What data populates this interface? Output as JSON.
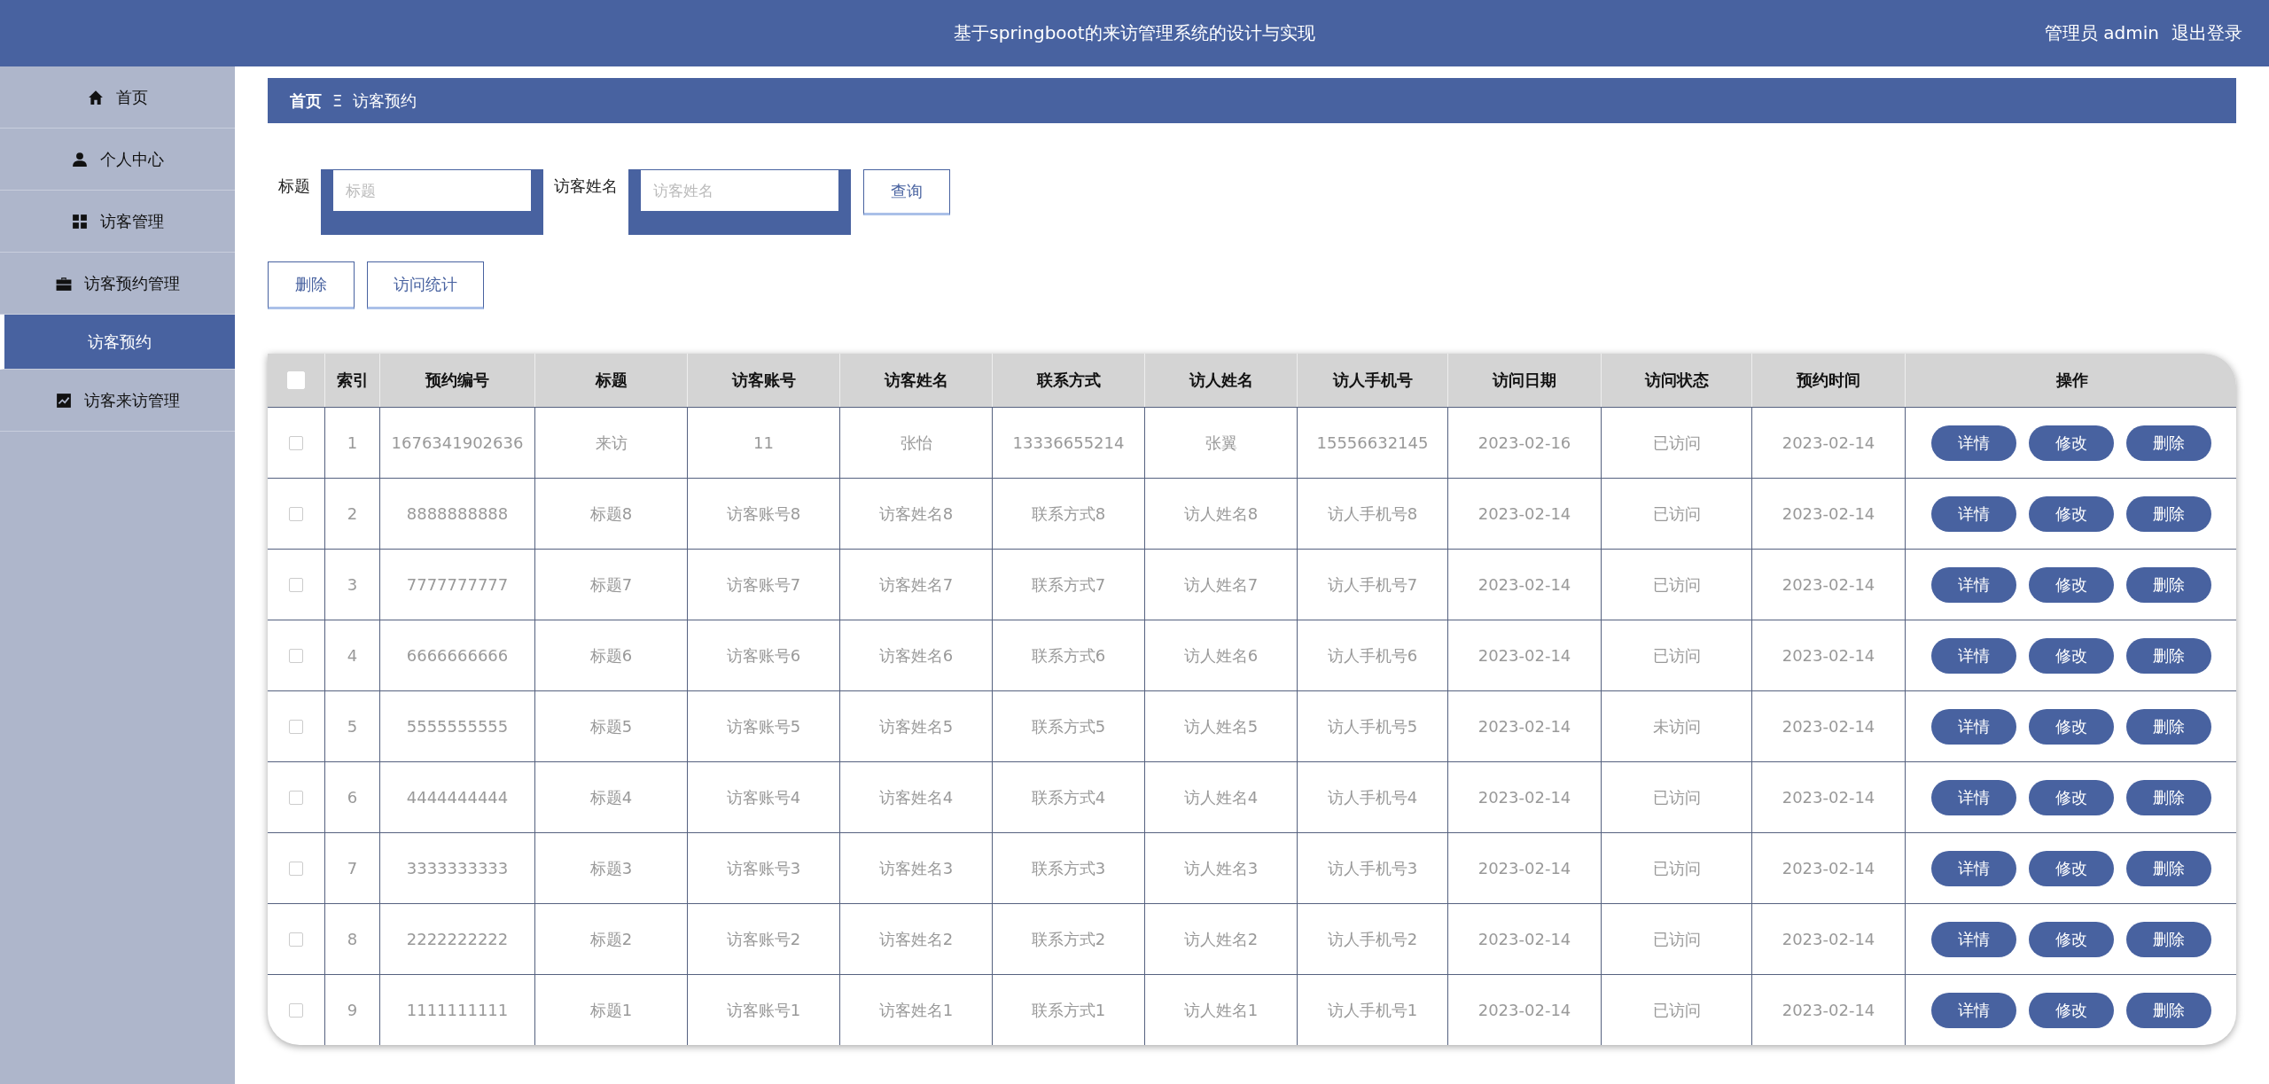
{
  "header": {
    "title": "基于springboot的来访管理系统的设计与实现",
    "user": "管理员 admin",
    "logout": "退出登录"
  },
  "sidebar": {
    "items": [
      {
        "label": "首页",
        "kind": "menu",
        "selected": false
      },
      {
        "label": "个人中心",
        "kind": "menu",
        "selected": false
      },
      {
        "label": "访客管理",
        "kind": "menu",
        "selected": false
      },
      {
        "label": "访客预约管理",
        "kind": "menu",
        "selected": false
      },
      {
        "label": "访客预约",
        "kind": "sub",
        "selected": true
      },
      {
        "label": "访客来访管理",
        "kind": "menu",
        "selected": false
      }
    ]
  },
  "breadcrumb": {
    "home": "首页",
    "separator": "Ξ",
    "current": "访客预约"
  },
  "search": {
    "fields": [
      {
        "label": "标题",
        "placeholder": "标题"
      },
      {
        "label": "访客姓名",
        "placeholder": "访客姓名"
      }
    ],
    "button": "查询"
  },
  "toolbar": [
    "删除",
    "访问统计"
  ],
  "table": {
    "header_checked": false,
    "columns": [
      "索引",
      "预约编号",
      "标题",
      "访客账号",
      "访客姓名",
      "联系方式",
      "访人姓名",
      "访人手机号",
      "访问日期",
      "访问状态",
      "预约时间",
      "操作"
    ],
    "rows": [
      {
        "checked": false,
        "cells": [
          "1",
          "1676341902636",
          "来访",
          "11",
          "张怡",
          "13336655214",
          "张翼",
          "15556632145",
          "2023-02-16",
          "已访问",
          "2023-02-14"
        ],
        "actions": [
          "详情",
          "修改",
          "删除"
        ]
      },
      {
        "checked": false,
        "cells": [
          "2",
          "8888888888",
          "标题8",
          "访客账号8",
          "访客姓名8",
          "联系方式8",
          "访人姓名8",
          "访人手机号8",
          "2023-02-14",
          "已访问",
          "2023-02-14"
        ],
        "actions": [
          "详情",
          "修改",
          "删除"
        ]
      },
      {
        "checked": false,
        "cells": [
          "3",
          "7777777777",
          "标题7",
          "访客账号7",
          "访客姓名7",
          "联系方式7",
          "访人姓名7",
          "访人手机号7",
          "2023-02-14",
          "已访问",
          "2023-02-14"
        ],
        "actions": [
          "详情",
          "修改",
          "删除"
        ]
      },
      {
        "checked": false,
        "cells": [
          "4",
          "6666666666",
          "标题6",
          "访客账号6",
          "访客姓名6",
          "联系方式6",
          "访人姓名6",
          "访人手机号6",
          "2023-02-14",
          "已访问",
          "2023-02-14"
        ],
        "actions": [
          "详情",
          "修改",
          "删除"
        ]
      },
      {
        "checked": false,
        "cells": [
          "5",
          "5555555555",
          "标题5",
          "访客账号5",
          "访客姓名5",
          "联系方式5",
          "访人姓名5",
          "访人手机号5",
          "2023-02-14",
          "未访问",
          "2023-02-14"
        ],
        "actions": [
          "详情",
          "修改",
          "删除"
        ]
      },
      {
        "checked": false,
        "cells": [
          "6",
          "4444444444",
          "标题4",
          "访客账号4",
          "访客姓名4",
          "联系方式4",
          "访人姓名4",
          "访人手机号4",
          "2023-02-14",
          "已访问",
          "2023-02-14"
        ],
        "actions": [
          "详情",
          "修改",
          "删除"
        ]
      },
      {
        "checked": false,
        "cells": [
          "7",
          "3333333333",
          "标题3",
          "访客账号3",
          "访客姓名3",
          "联系方式3",
          "访人姓名3",
          "访人手机号3",
          "2023-02-14",
          "已访问",
          "2023-02-14"
        ],
        "actions": [
          "详情",
          "修改",
          "删除"
        ]
      },
      {
        "checked": false,
        "cells": [
          "8",
          "2222222222",
          "标题2",
          "访客账号2",
          "访客姓名2",
          "联系方式2",
          "访人姓名2",
          "访人手机号2",
          "2023-02-14",
          "已访问",
          "2023-02-14"
        ],
        "actions": [
          "详情",
          "修改",
          "删除"
        ]
      },
      {
        "checked": false,
        "cells": [
          "9",
          "1111111111",
          "标题1",
          "访客账号1",
          "访客姓名1",
          "联系方式1",
          "访人姓名1",
          "访人手机号1",
          "2023-02-14",
          "已访问",
          "2023-02-14"
        ],
        "actions": [
          "详情",
          "修改",
          "删除"
        ]
      }
    ]
  }
}
